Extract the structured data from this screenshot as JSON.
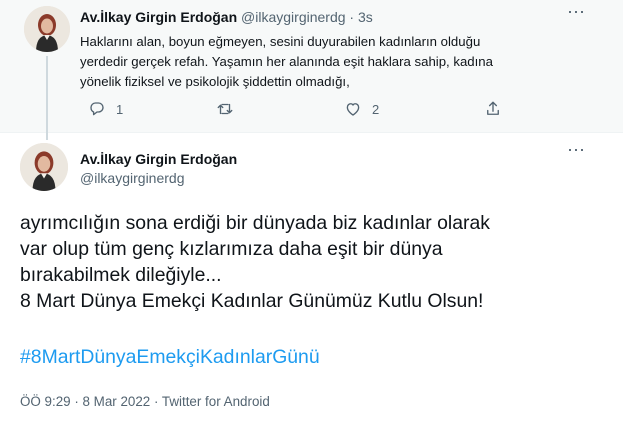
{
  "reply_tweet": {
    "author_name": "Av.İlkay Girgin Erdoğan",
    "author_handle": "@ilkaygirginerdg",
    "separator": "·",
    "time": "3s",
    "more_icon": "more-horizontal-icon",
    "text_lines": [
      "Haklarını alan, boyun eğmeyen, sesini duyurabilen kadınların olduğu",
      "yerdedir gerçek refah. Yaşamın her alanında eşit haklara sahip, kadına",
      "yönelik fiziksel ve psikolojik şiddettin olmadığı,"
    ],
    "actions": {
      "reply_count": "1",
      "retweet_count": "",
      "like_count": "2",
      "share_label": ""
    }
  },
  "main_tweet": {
    "author_name": "Av.İlkay Girgin Erdoğan",
    "author_handle": "@ilkaygirginerdg",
    "more_icon": "more-horizontal-icon",
    "text_lines": [
      "ayrımcılığın sona erdiği bir dünyada biz kadınlar olarak",
      "var olup tüm genç kızlarımıza daha eşit bir dünya",
      "bırakabilmek dileğiyle...",
      "8 Mart Dünya Emekçi Kadınlar Günümüz Kutlu Olsun!"
    ],
    "hashtag": "#8MartDünyaEmekçiKadınlarGünü",
    "meta": "ÖÖ 9:29 · 8 Mar 2022 · Twitter for Android"
  },
  "colors": {
    "accent": "#1d9bf0",
    "text": "#0f1419",
    "muted": "#536471",
    "thread_bg": "#f7f9f9"
  }
}
